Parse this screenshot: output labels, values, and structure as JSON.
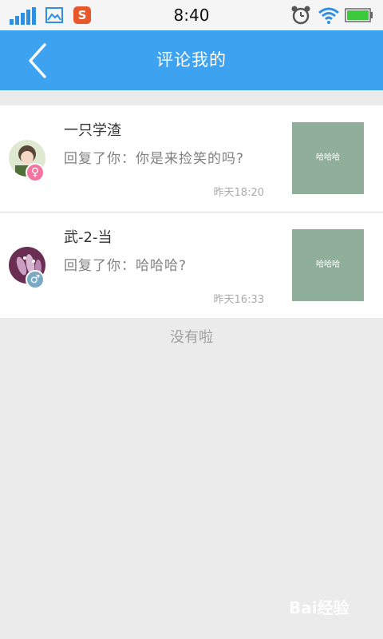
{
  "status_bar": {
    "time": "8:40",
    "icons": [
      "signal-icon",
      "gallery-icon",
      "sogou-input-icon",
      "alarm-icon",
      "wifi-icon",
      "battery-icon"
    ],
    "sogou_glyph": "S"
  },
  "header": {
    "title": "评论我的",
    "background": "#3da2ef"
  },
  "comments": [
    {
      "name": "一只学渣",
      "reply": "回复了你：你是来捡笑的吗?",
      "time": "昨天18:20",
      "gender": "female",
      "gender_symbol": "♀",
      "thumb_text": "哈哈哈"
    },
    {
      "name": "武-2-当",
      "reply": "回复了你：哈哈哈?",
      "time": "昨天16:33",
      "gender": "male",
      "gender_symbol": "♂",
      "thumb_text": "哈哈哈"
    }
  ],
  "empty_text": "没有啦",
  "watermark": "Bai经验",
  "colors": {
    "accent": "#3da2ef",
    "female": "#f2759f",
    "male": "#7aa9c6",
    "thumb": "#8faf9b"
  }
}
